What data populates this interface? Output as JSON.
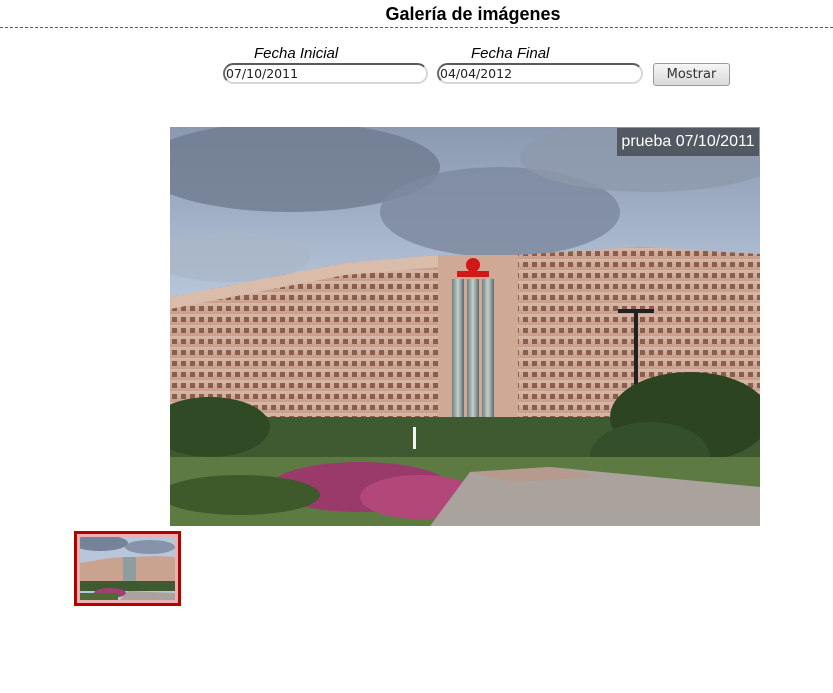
{
  "header": {
    "title": "Galería de imágenes"
  },
  "filters": {
    "start_label": "Fecha Inicial",
    "start_value": "07/10/2011",
    "end_label": "Fecha Final",
    "end_value": "04/04/2012",
    "submit_label": "Mostrar"
  },
  "gallery": {
    "caption": "prueba 07/10/2011",
    "thumbnail_count": 1,
    "selected_thumbnail": 1
  },
  "colors": {
    "title_rule": "#2d6e6e",
    "thumb_border": "#b30000",
    "caption_bg": "#464a52"
  }
}
